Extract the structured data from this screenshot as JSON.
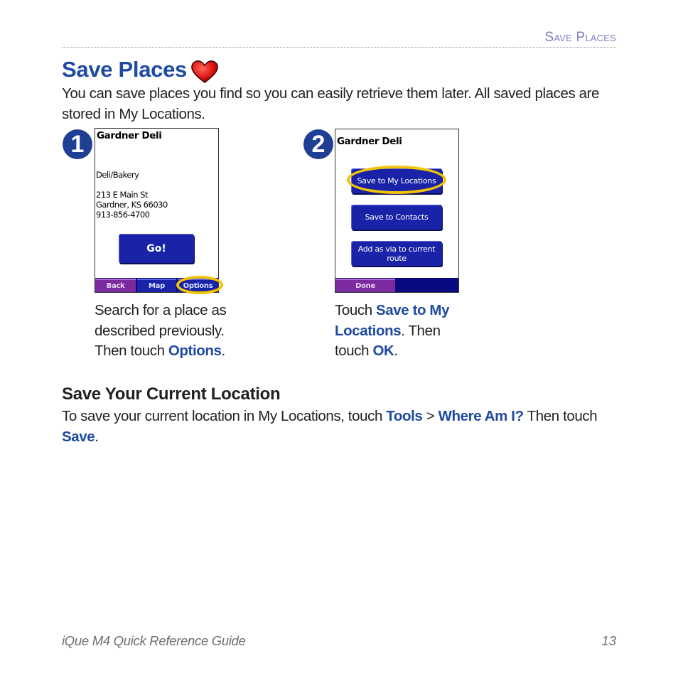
{
  "running_head": "Save Places",
  "title": "Save Places",
  "title_icon": "heart-icon",
  "intro": "You can save places you find so you can easily retrieve them later. All saved places are stored in My Locations.",
  "colors": {
    "accent_blue": "#1f4aa0",
    "running_head": "#7a80c4",
    "device_button": "#1a23a8",
    "softkey_purple": "#7b2aa0",
    "highlight": "#f2c300"
  },
  "steps": [
    {
      "number": "1",
      "screen": {
        "title": "Gardner Deli",
        "category": "Deli/Bakery",
        "address_line1": "213 E Main St",
        "address_line2": "Gardner, KS 66030",
        "phone": "913-856-4700",
        "go_button": "Go!",
        "softkeys": [
          "Back",
          "Map",
          "Options"
        ],
        "highlighted": "Options"
      },
      "caption": {
        "text1": "Search for a place as described previously. Then touch ",
        "kw1": "Options",
        "text2": "."
      }
    },
    {
      "number": "2",
      "screen": {
        "title": "Gardner Deli",
        "options": [
          "Save to My Locations",
          "Save to Contacts",
          "Add as via to current route"
        ],
        "softkeys": [
          "Done"
        ],
        "highlighted": "Save to My Locations"
      },
      "caption": {
        "text1": "Touch ",
        "kw1": "Save to My Locations",
        "text2": ". Then touch ",
        "kw2": "OK",
        "text3": "."
      }
    }
  ],
  "section": {
    "heading": "Save Your Current Location",
    "text1": "To save your current location in My Locations, touch ",
    "kw1": "Tools",
    "text2": " > ",
    "kw2": "Where Am I?",
    "text3": " Then touch ",
    "kw3": "Save",
    "text4": "."
  },
  "footer": {
    "guide_title": "iQue M4 Quick Reference Guide",
    "page_number": "13"
  }
}
